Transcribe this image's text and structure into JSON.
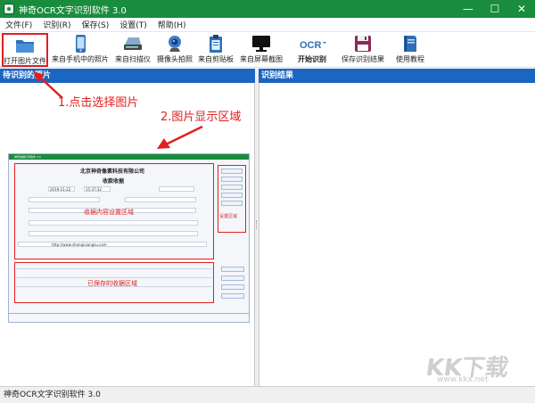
{
  "window": {
    "title": "神奇OCR文字识别软件 3.0",
    "minimize_glyph": "—",
    "maximize_glyph": "☐",
    "close_glyph": "✕"
  },
  "menu": [
    {
      "label": "文件(F)"
    },
    {
      "label": "识别(R)"
    },
    {
      "label": "保存(S)"
    },
    {
      "label": "设置(T)"
    },
    {
      "label": "帮助(H)"
    }
  ],
  "toolbar": {
    "items": [
      {
        "label": "打开图片文件",
        "icon": "folder-icon"
      },
      {
        "label": "来自手机中的照片",
        "icon": "phone-icon"
      },
      {
        "label": "来自扫描仪",
        "icon": "scanner-icon"
      },
      {
        "label": "摄像头拍照",
        "icon": "webcam-icon"
      },
      {
        "label": "来自剪贴板",
        "icon": "clipboard-icon"
      },
      {
        "label": "来自屏幕截图",
        "icon": "monitor-icon"
      },
      {
        "label": "开始识别",
        "icon": "ocr-icon",
        "icon_text": "OCR"
      },
      {
        "label": "保存识别结果",
        "icon": "save-icon"
      },
      {
        "label": "使用教程",
        "icon": "book-icon"
      }
    ]
  },
  "panels": {
    "left_title": "待识别的照片",
    "right_title": "识别结果"
  },
  "annotations": {
    "step1": "1.点击选择图片",
    "step2": "2.图片显示区域"
  },
  "preview": {
    "window_title": "神奇收据打印软件 3.0",
    "company": "北京神奇像素科技有限公司",
    "doc_title": "收款收据",
    "content_area_label": "收据内容设置区域",
    "save_area_label": "已保存的收据区域",
    "preview_area_label": "设置区域",
    "url_text": "http://www.shenqixiangsu.com",
    "date_text": "2019-11-22",
    "time_text": "15:37:32"
  },
  "statusbar": {
    "text": "神奇OCR文字识别软件 3.0"
  },
  "watermark": {
    "brand": "KK下载",
    "url": "www.kkx.net"
  },
  "colors": {
    "titlebar": "#1a8c3e",
    "panel_header": "#1a66c0",
    "annotation": "#e02020"
  }
}
